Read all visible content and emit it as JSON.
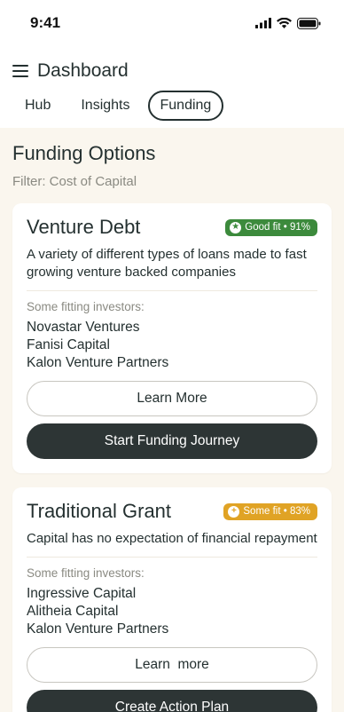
{
  "status": {
    "time": "9:41"
  },
  "header": {
    "title": "Dashboard",
    "tabs": [
      {
        "label": "Hub"
      },
      {
        "label": "Insights"
      },
      {
        "label": "Funding"
      }
    ],
    "active_tab": "Funding"
  },
  "main": {
    "section_title": "Funding Options",
    "filter": "Filter: Cost of Capital",
    "cards": [
      {
        "title": "Venture Debt",
        "badge": {
          "label": "Good fit • 91%",
          "color": "#3c8a3c",
          "icon": "star-icon"
        },
        "description": "A variety of different types of loans made to fast growing venture backed companies",
        "investors_label": "Some fitting investors:",
        "investors": [
          "Novastar Ventures",
          "Fanisi Capital",
          "Kalon Venture Partners"
        ],
        "secondary_button": "Learn More",
        "primary_button": "Start Funding Journey"
      },
      {
        "title": "Traditional Grant",
        "badge": {
          "label": "Some fit • 83%",
          "color": "#e0a325",
          "icon": "plus-icon"
        },
        "description": "Capital has no expectation of financial repayment",
        "investors_label": "Some fitting investors:",
        "investors": [
          "Ingressive Capital",
          "Alitheia Capital",
          "Kalon Venture Partners"
        ],
        "secondary_button": "Learn  more",
        "primary_button": "Create Action Plan"
      }
    ]
  },
  "colors": {
    "background": "#faf6ee",
    "primary_dark": "#2d3535",
    "good_fit": "#3c8a3c",
    "some_fit": "#e0a325"
  }
}
